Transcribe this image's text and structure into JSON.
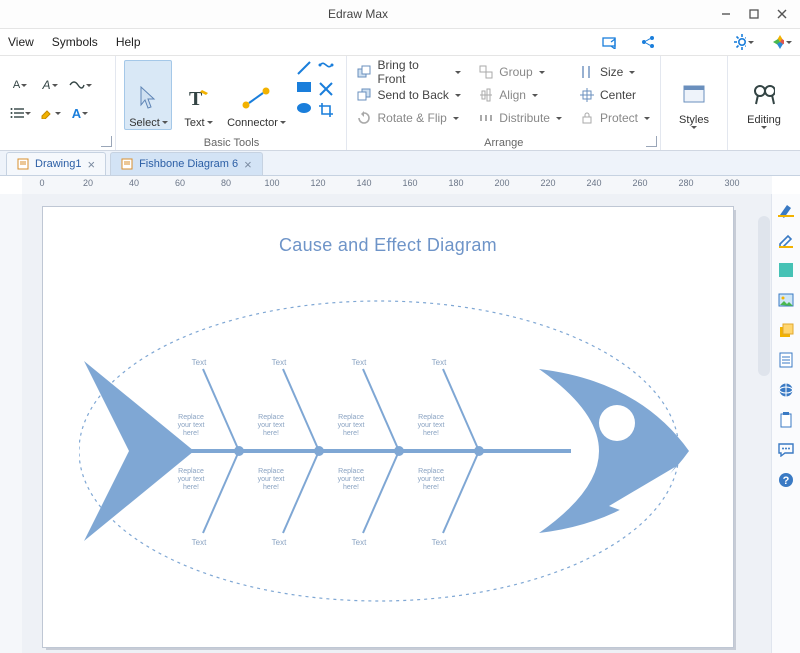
{
  "app": {
    "title": "Edraw Max"
  },
  "menu": {
    "view": "View",
    "symbols": "Symbols",
    "help": "Help"
  },
  "ribbon": {
    "basic_tools_label": "Basic Tools",
    "arrange_label": "Arrange",
    "select": "Select",
    "text": "Text",
    "connector": "Connector",
    "bring_front": "Bring to Front",
    "send_back": "Send to Back",
    "rotate_flip": "Rotate & Flip",
    "group": "Group",
    "align": "Align",
    "distribute": "Distribute",
    "size": "Size",
    "center": "Center",
    "protect": "Protect",
    "styles": "Styles",
    "editing": "Editing"
  },
  "tabs": [
    {
      "label": "Drawing1",
      "active": false
    },
    {
      "label": "Fishbone Diagram 6",
      "active": true
    }
  ],
  "ruler_ticks": [
    "0",
    "20",
    "40",
    "60",
    "80",
    "100",
    "120",
    "140",
    "160",
    "180",
    "200",
    "220",
    "240",
    "260",
    "280",
    "300"
  ],
  "diagram": {
    "title": "Cause and Effect Diagram",
    "bone_text": "Text",
    "cause_text": "Replace your text here!"
  },
  "colors": {
    "accent": "#7fa7d4",
    "fish": "#7fa7d4",
    "outline": "#6e94c8"
  }
}
